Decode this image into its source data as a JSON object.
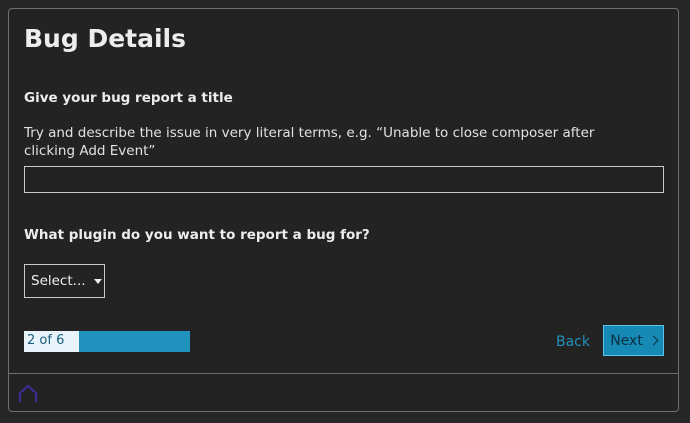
{
  "form": {
    "title": "Bug Details",
    "q1_label": "Give your bug report a title",
    "q1_description": "Try and describe the issue in very literal terms, e.g. “Unable to close composer after clicking Add Event”",
    "q1_input_value": "",
    "q2_label": "What plugin do you want to report a bug for?",
    "q2_select_value": "Select..."
  },
  "progress": {
    "text": "2 of 6",
    "current": 2,
    "total": 6
  },
  "nav": {
    "back_label": "Back",
    "next_label": "Next"
  },
  "icons": {
    "select_caret": "caret-down-icon",
    "next_chevron": "chevron-right-icon",
    "footer_logo": "home-logo-icon"
  },
  "colors": {
    "accent": "#2191bd",
    "background": "#232323",
    "logo": "#3b2d8f"
  }
}
